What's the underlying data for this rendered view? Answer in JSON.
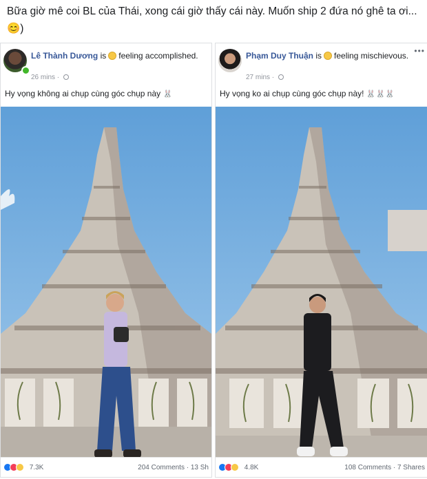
{
  "caption": "Bữa giờ mê coi BL của Thái, xong cái giờ thấy cái này. Muốn ship 2 đứa nó ghê ta ơi...😊)",
  "posts": [
    {
      "author": "Lê Thành Dương",
      "is": "is",
      "feeling": "feeling accomplished.",
      "time": "26 mins",
      "text": "Hy vọng không ai chụp cùng góc chụp này",
      "text_emoji": "🐰",
      "reactions_count": "7.3K",
      "comments": "204 Comments",
      "shares": "13 Sh",
      "reaction_icons": [
        "like-icon",
        "love-icon",
        "haha-icon"
      ],
      "shirt_color": "#c5b8de",
      "pants_color": "#2d4f8c",
      "shoe_color": "#2a2522"
    },
    {
      "author": "Phạm Duy Thuận",
      "is": "is",
      "feeling": "feeling mischievous.",
      "time": "27 mins",
      "text": "Hy vọng ko ai chụp cùng góc chụp này!",
      "text_emoji": "🐰🐰🐰",
      "reactions_count": "4.8K",
      "comments": "108 Comments",
      "shares": "7 Shares",
      "more_icon": "•••",
      "reaction_icons": [
        "like-icon",
        "love-icon",
        "haha-icon"
      ],
      "shirt_color": "#1c1c1f",
      "pants_color": "#1c1c1f",
      "shoe_color": "#f2f2f2"
    }
  ],
  "colors": {
    "sky": "#7fb6e2",
    "temple_stone": "#c9c2b8",
    "temple_shadow": "#8f8579",
    "ground": "#b8b1a8",
    "link": "#385898"
  }
}
